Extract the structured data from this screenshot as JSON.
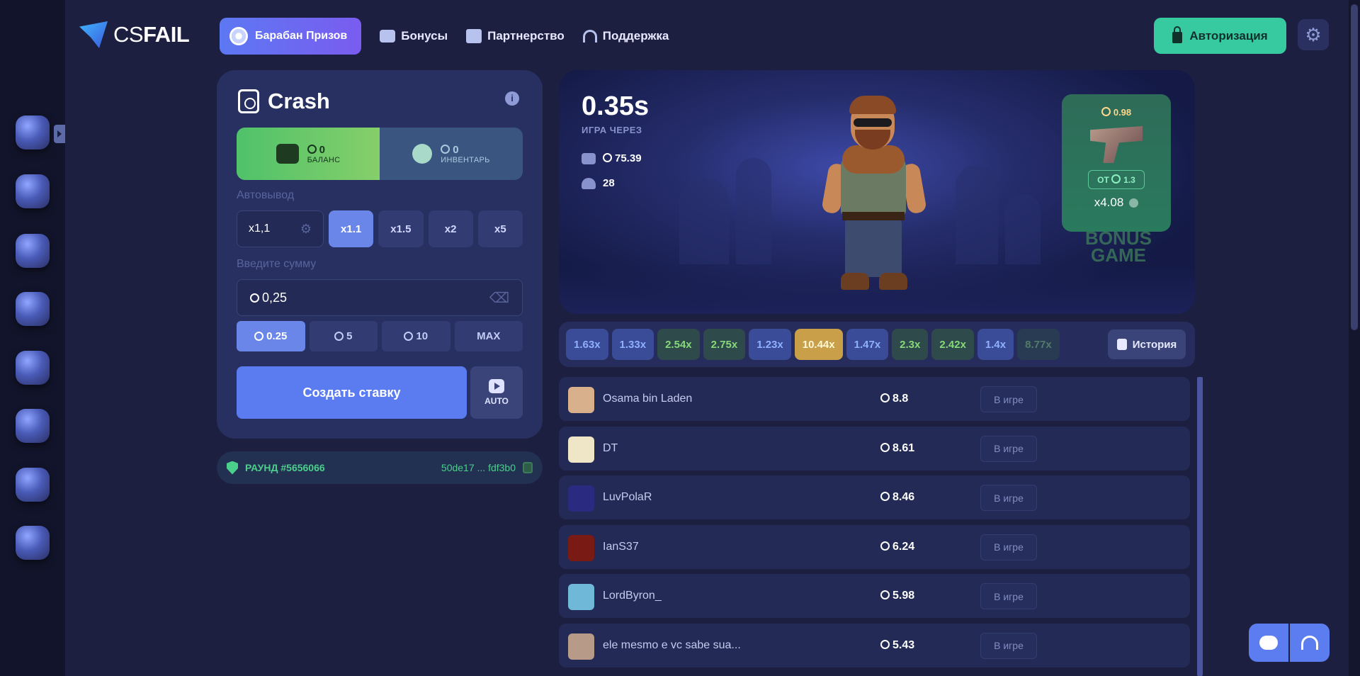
{
  "brand": {
    "logo_cs": "CS",
    "logo_fail": "FAIL"
  },
  "nav": {
    "prize_wheel": "Барабан Призов",
    "bonuses": "Бонусы",
    "partnership": "Партнерство",
    "support": "Поддержка"
  },
  "header": {
    "auth_label": "Авторизация"
  },
  "crash": {
    "title": "Crash",
    "balance_value": "0",
    "balance_label": "БАЛАНС",
    "inventory_value": "0",
    "inventory_label": "ИНВЕНТАРЬ",
    "autocashout_label": "Автовывод",
    "autocashout_value": "x1,1",
    "multipliers": [
      "x1.1",
      "x1.5",
      "x2",
      "x5"
    ],
    "amount_label": "Введите сумму",
    "amount_value": "0,25",
    "quick_amounts": [
      "0.25",
      "5",
      "10",
      "MAX"
    ],
    "create_bet": "Создать ставку",
    "auto_label": "AUTO"
  },
  "round": {
    "label": "РАУНД #5656066",
    "hash": "50de17 ... fdf3b0"
  },
  "stage": {
    "timer": "0.35s",
    "timer_label": "ИГРА ЧЕРЕЗ",
    "bank": "75.39",
    "players_count": "28",
    "bonus_price": "0.98",
    "bonus_from": "ОТ",
    "bonus_from_value": "1.3",
    "bonus_mult": "x4.08",
    "bonus_game_line1": "BONUS",
    "bonus_game_line2": "GAME"
  },
  "history": {
    "values": [
      "1.63x",
      "1.33x",
      "2.54x",
      "2.75x",
      "1.23x",
      "10.44x",
      "1.47x",
      "2.3x",
      "2.42x",
      "1.4x",
      "8.77x"
    ],
    "kinds": [
      "blue",
      "blue",
      "green",
      "green",
      "blue",
      "gold",
      "blue",
      "green",
      "green",
      "blue",
      "green"
    ],
    "button": "История"
  },
  "players": [
    {
      "name": "Osama bin Laden",
      "amount": "8.8",
      "status": "В игре",
      "avatar_color": "#d9b08c"
    },
    {
      "name": "DT",
      "amount": "8.61",
      "status": "В игре",
      "avatar_color": "#efe6c8"
    },
    {
      "name": "LuvPolaR",
      "amount": "8.46",
      "status": "В игре",
      "avatar_color": "#2a2a80"
    },
    {
      "name": "IanS37",
      "amount": "6.24",
      "status": "В игре",
      "avatar_color": "#7a1a14"
    },
    {
      "name": "LordByron_",
      "amount": "5.98",
      "status": "В игре",
      "avatar_color": "#6fb8d8"
    },
    {
      "name": "ele mesmo e vc sabe sua...",
      "amount": "5.43",
      "status": "В игре",
      "avatar_color": "#b89a88"
    }
  ]
}
